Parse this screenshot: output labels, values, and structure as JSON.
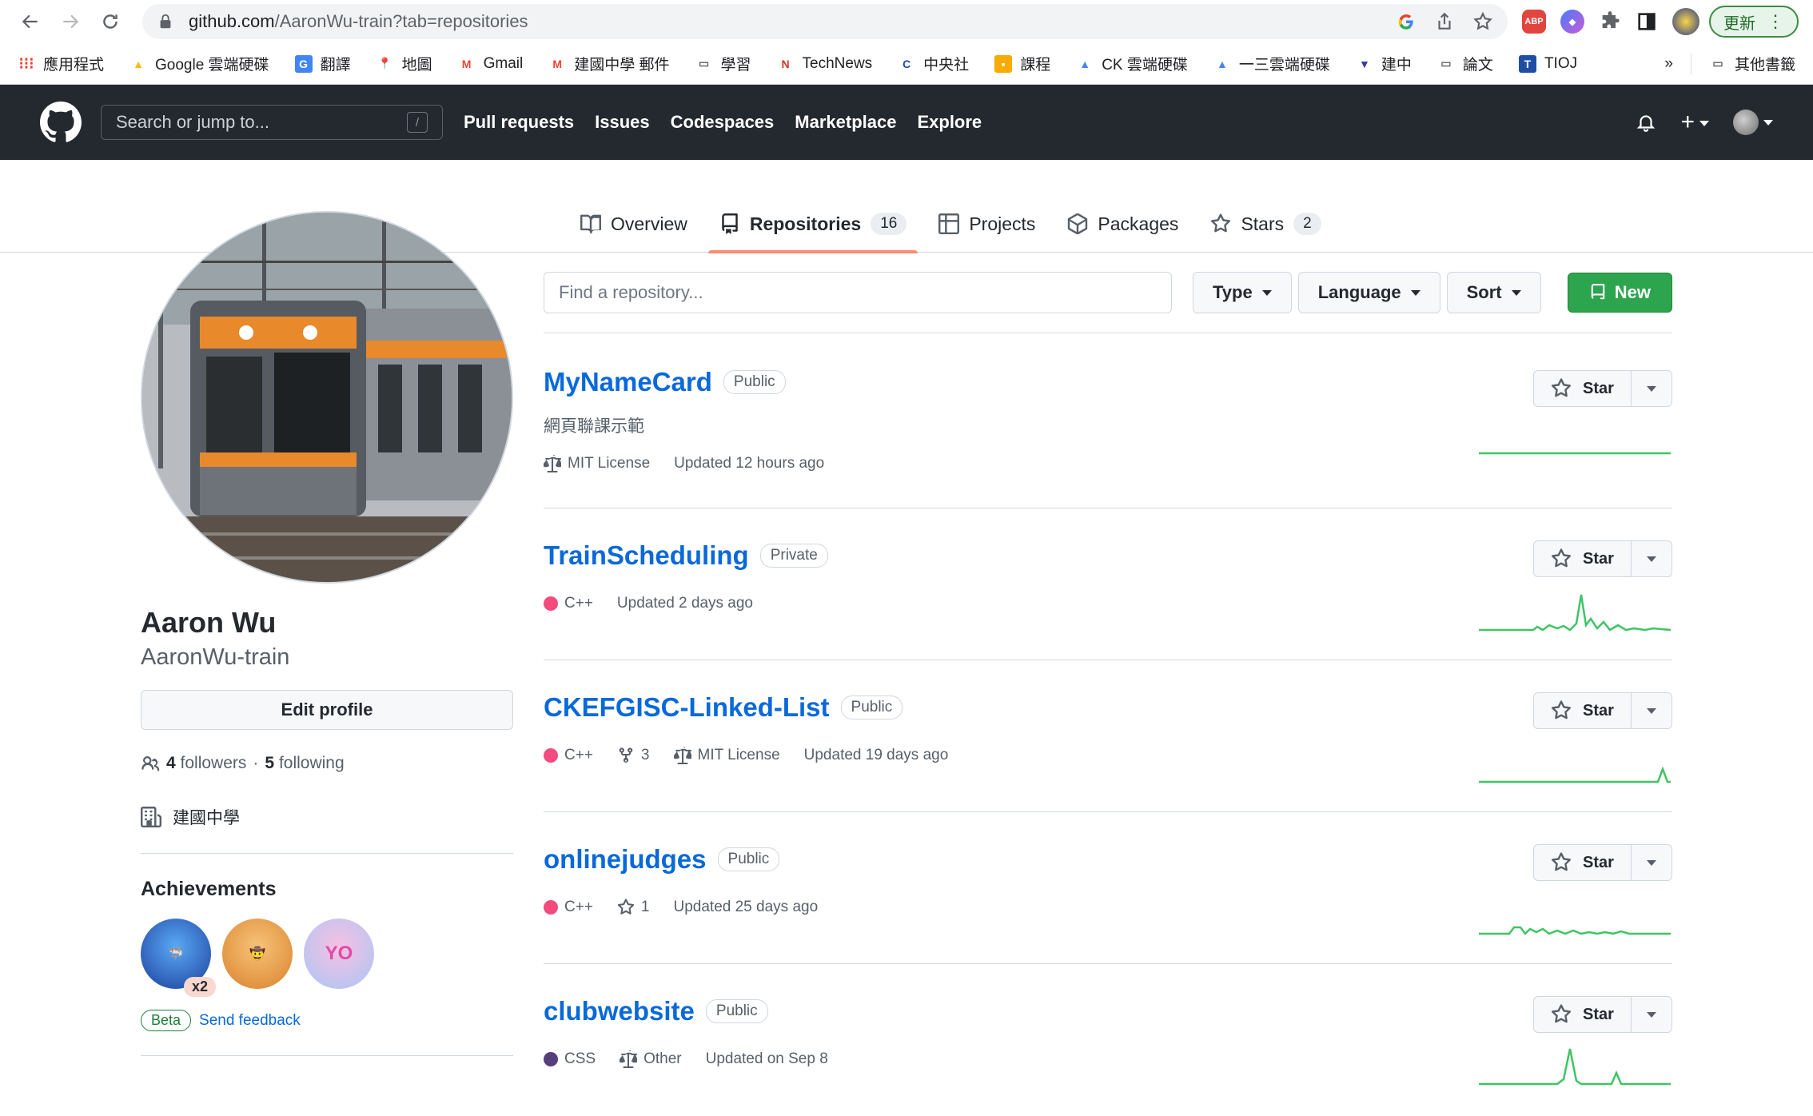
{
  "browser": {
    "url_host": "github.com",
    "url_path": "/AaronWu-train?tab=repositories",
    "update_label": "更新",
    "bookmarks": [
      "應用程式",
      "Google 雲端硬碟",
      "翻譯",
      "地圖",
      "Gmail",
      "建國中學 郵件",
      "學習",
      "TechNews",
      "中央社",
      "課程",
      "CK 雲端硬碟",
      "一三雲端硬碟",
      "建中",
      "論文",
      "TIOJ"
    ],
    "bookmarks_overflow": "»",
    "other_bookmarks": "其他書籤"
  },
  "header": {
    "search_placeholder": "Search or jump to...",
    "search_shortcut": "/",
    "nav": [
      "Pull requests",
      "Issues",
      "Codespaces",
      "Marketplace",
      "Explore"
    ]
  },
  "tabs": {
    "overview": "Overview",
    "repositories": "Repositories",
    "repositories_count": "16",
    "projects": "Projects",
    "packages": "Packages",
    "stars": "Stars",
    "stars_count": "2"
  },
  "profile": {
    "full_name": "Aaron Wu",
    "login": "AaronWu-train",
    "edit_label": "Edit profile",
    "followers_count": "4",
    "followers_label": "followers",
    "separator": "·",
    "following_count": "5",
    "following_label": "following",
    "organization": "建國中學",
    "achievements_title": "Achievements",
    "badge_multiplier": "x2",
    "beta_label": "Beta",
    "feedback_label": "Send feedback"
  },
  "filters": {
    "find_placeholder": "Find a repository...",
    "type_label": "Type",
    "language_label": "Language",
    "sort_label": "Sort",
    "new_label": "New"
  },
  "repos": [
    {
      "name": "MyNameCard",
      "visibility": "Public",
      "description": "網頁聯課示範",
      "license": "MIT License",
      "updated": "Updated 12 hours ago",
      "star_label": "Star"
    },
    {
      "name": "TrainScheduling",
      "visibility": "Private",
      "language": "C++",
      "updated": "Updated 2 days ago",
      "star_label": "Star"
    },
    {
      "name": "CKEFGISC-Linked-List",
      "visibility": "Public",
      "language": "C++",
      "forks": "3",
      "license": "MIT License",
      "updated": "Updated 19 days ago",
      "star_label": "Star"
    },
    {
      "name": "onlinejudges",
      "visibility": "Public",
      "language": "C++",
      "stars": "1",
      "updated": "Updated 25 days ago",
      "star_label": "Star"
    },
    {
      "name": "clubwebsite",
      "visibility": "Public",
      "language": "CSS",
      "license": "Other",
      "updated": "Updated on Sep 8",
      "star_label": "Star"
    }
  ],
  "colors": {
    "cpp": "#f34b7d",
    "css": "#563d7c",
    "link": "#0969da",
    "new_button": "#2da44e",
    "header_bg": "#24292f",
    "sparkline": "#40c463"
  }
}
